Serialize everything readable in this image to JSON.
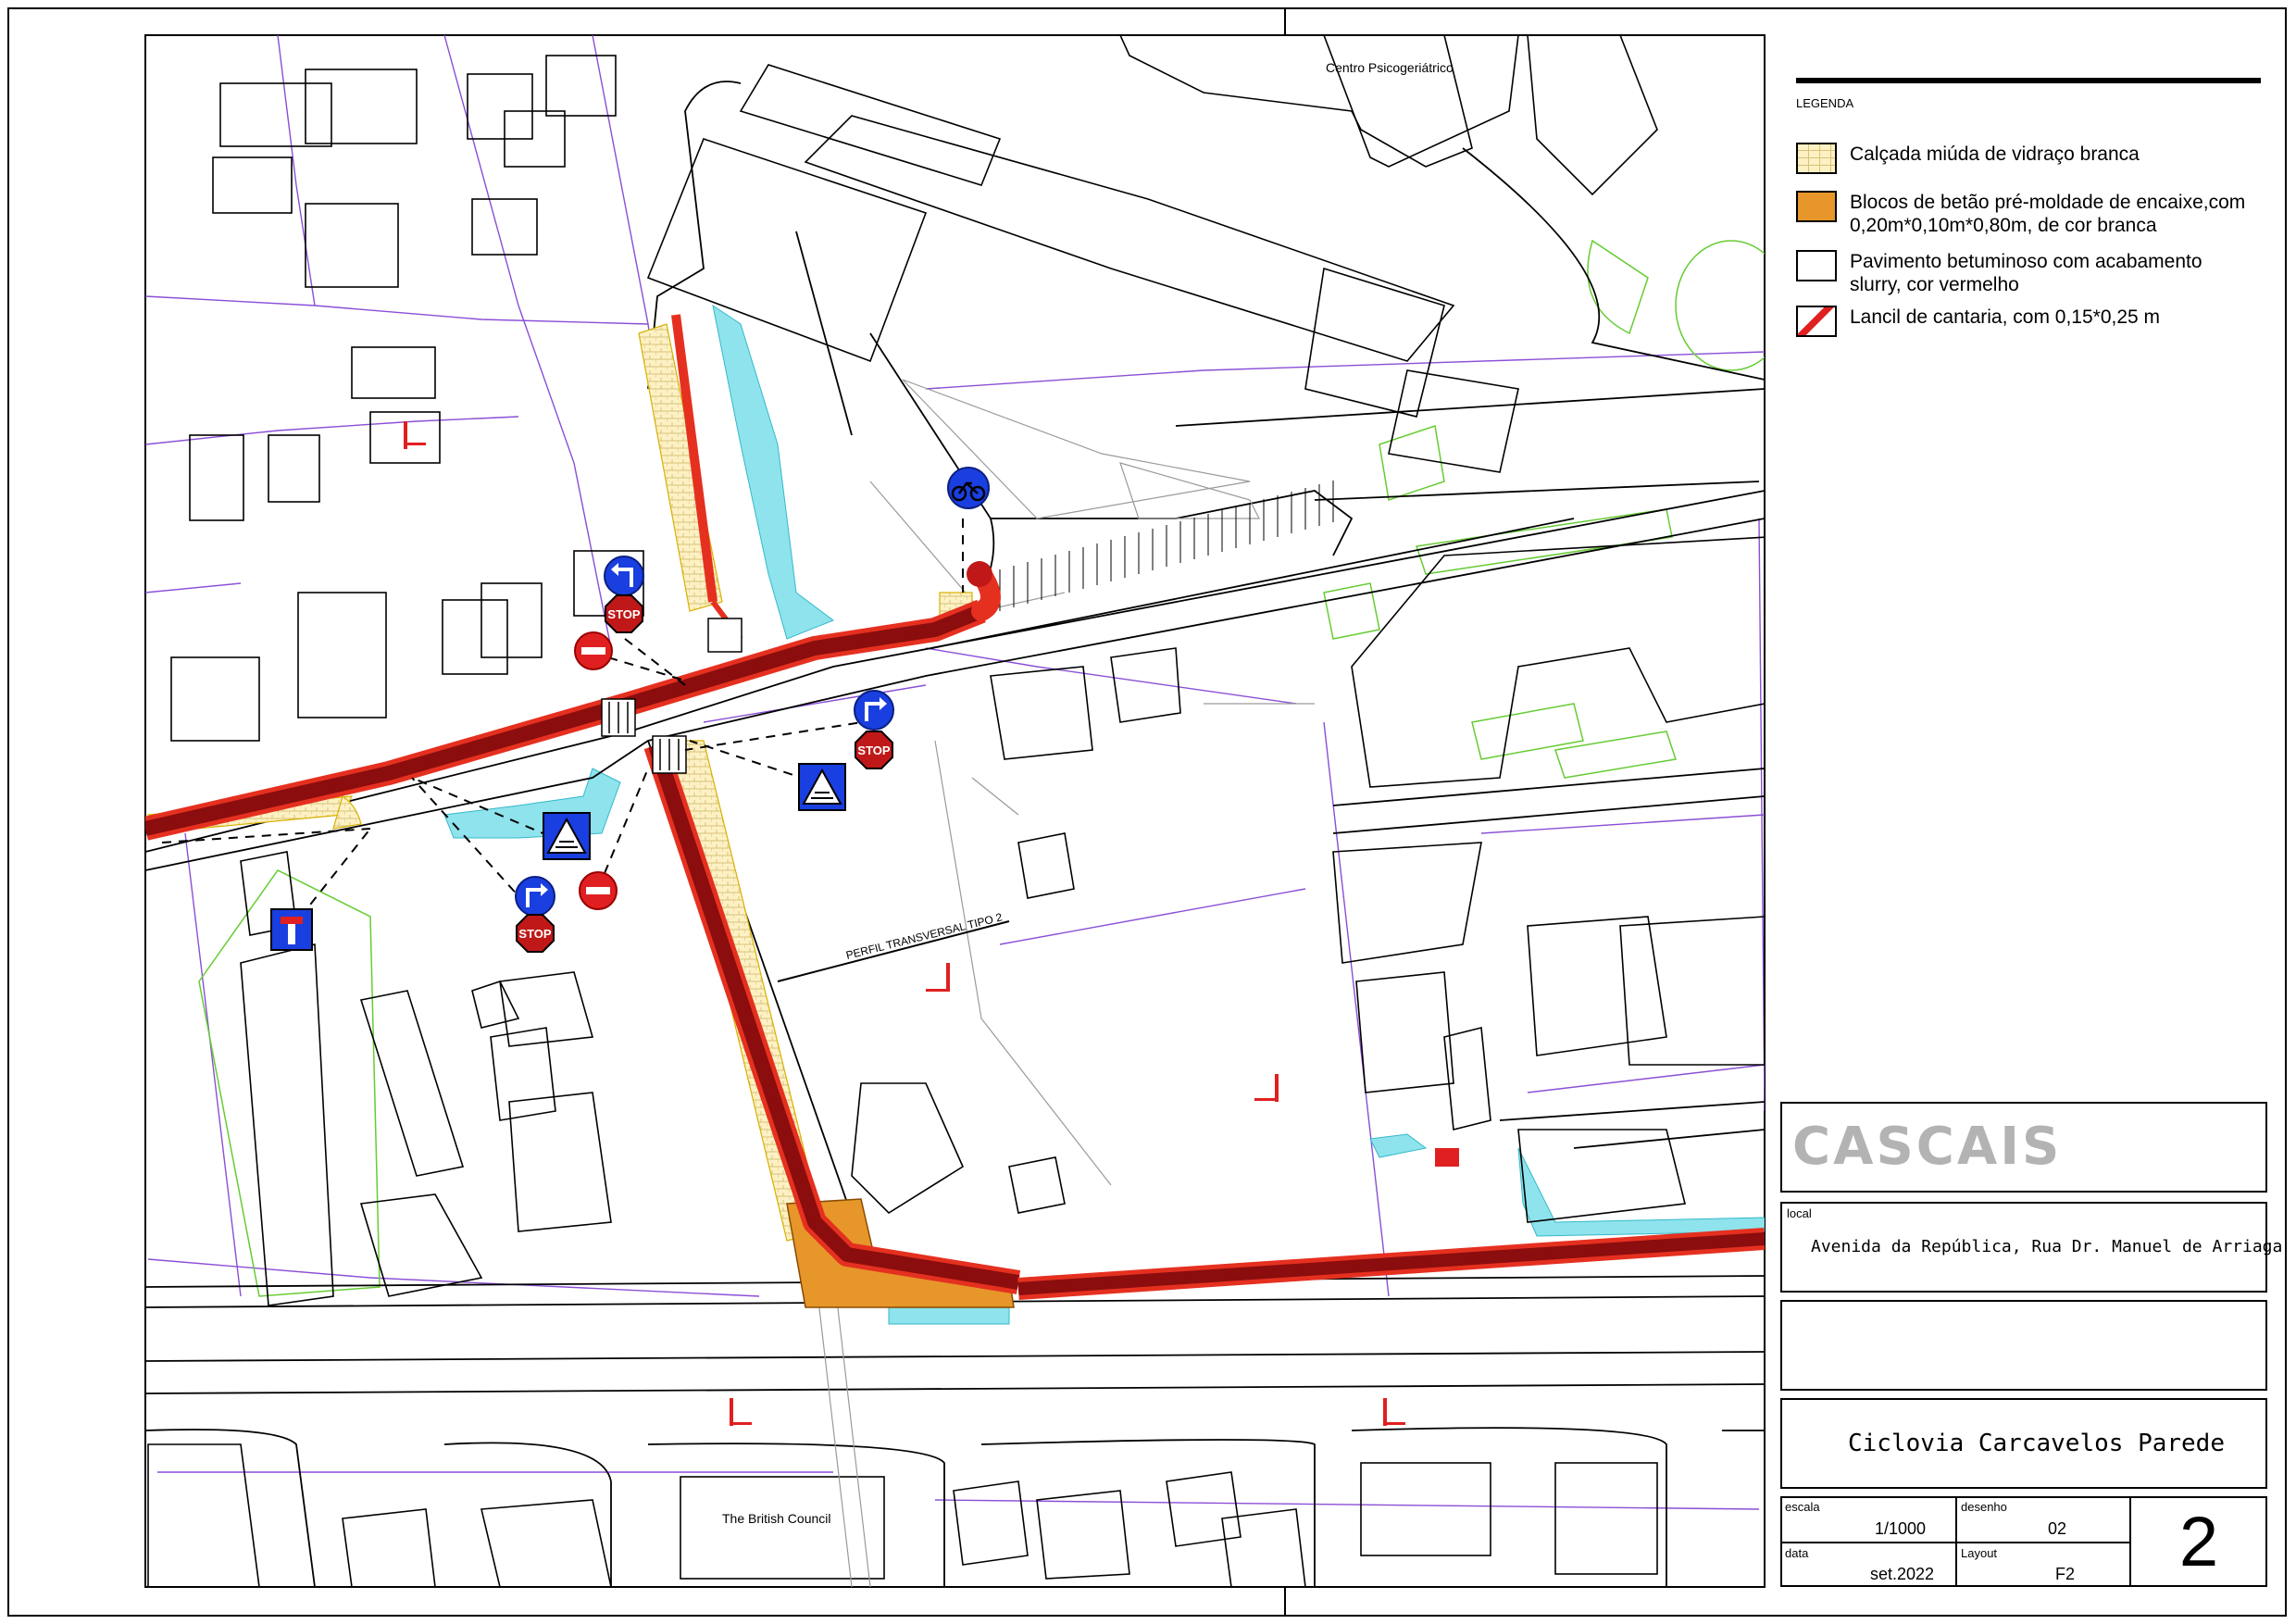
{
  "map": {
    "place_labels": {
      "centro": "Centro Psicogeriátrico",
      "british_council": "The British Council"
    },
    "section_label": "PERFIL TRANSVERSAL TIPO 2",
    "sign_texts": {
      "stop": "STOP"
    },
    "colors": {
      "cycle_lane": "#b01010",
      "cycle_lane_edge": "#e53020",
      "calcada": "#fdf1c4",
      "blocos": "#e7962a",
      "water": "#8ee3ec",
      "parcel_lines": "#8a4fd6",
      "green_lines": "#66cc33",
      "sign_blue": "#1a3fe0",
      "sign_red": "#e02020"
    },
    "icons": [
      "turn-left-sign-icon",
      "turn-right-sign-icon",
      "stop-sign-icon",
      "no-entry-sign-icon",
      "pedestrian-crossing-sign-icon",
      "bicycle-sign-icon",
      "dead-end-sign-icon"
    ]
  },
  "legend": {
    "title": "LEGENDA",
    "items": [
      {
        "label": "Calçada miúda de vidraço branca"
      },
      {
        "label": "Blocos de betão pré-moldade de encaixe,com 0,20m*0,10m*0,80m, de cor branca"
      },
      {
        "label": "Pavimento betuminoso com acabamento slurry, cor vermelho"
      },
      {
        "label": "Lancil de cantaria, com 0,15*0,25 m"
      }
    ]
  },
  "title_block": {
    "brand": "CASCAIS",
    "local_label": "local",
    "local_value": "Avenida da República, Rua Dr. Manuel de Arriaga",
    "project": "Ciclovia Carcavelos Parede",
    "escala_label": "escala",
    "escala_value": "1/1000",
    "desenho_label": "desenho",
    "desenho_value": "02",
    "data_label": "data",
    "data_value": "set.2022",
    "layout_label": "Layout",
    "layout_value": "F2",
    "sheet_number": "2"
  }
}
